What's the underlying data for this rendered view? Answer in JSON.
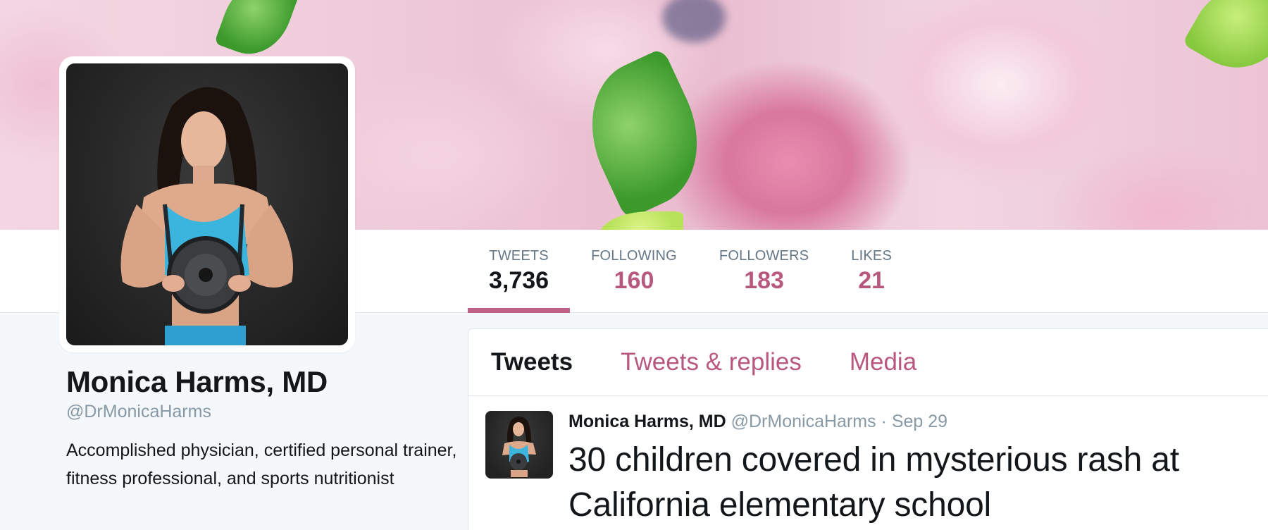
{
  "profile": {
    "name": "Monica Harms, MD",
    "handle": "@DrMonicaHarms",
    "bio": "Accomplished physician, certified personal trainer, fitness professional, and sports nutritionist"
  },
  "stats": [
    {
      "label": "TWEETS",
      "value": "3,736",
      "active": true
    },
    {
      "label": "FOLLOWING",
      "value": "160",
      "active": false
    },
    {
      "label": "FOLLOWERS",
      "value": "183",
      "active": false
    },
    {
      "label": "LIKES",
      "value": "21",
      "active": false
    }
  ],
  "timeline_tabs": [
    {
      "label": "Tweets",
      "active": true
    },
    {
      "label": "Tweets & replies",
      "active": false
    },
    {
      "label": "Media",
      "active": false
    }
  ],
  "tweet": {
    "author": "Monica Harms, MD",
    "handle": "@DrMonicaHarms",
    "separator": "·",
    "date": "Sep 29",
    "text": "30 children covered in mysterious rash at California elementary school"
  },
  "colors": {
    "accent": "#b8587f",
    "accent_underline": "#c06286",
    "text_primary": "#14171a",
    "text_secondary": "#657786",
    "muted": "#8899a6"
  },
  "icons": {
    "avatar": "profile-photo",
    "tweet_avatar": "profile-photo-small"
  }
}
